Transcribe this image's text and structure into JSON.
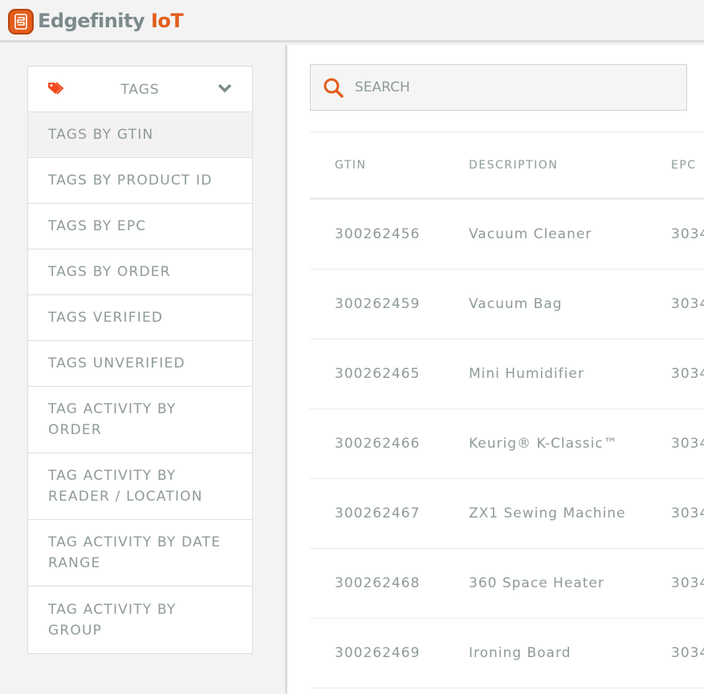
{
  "header": {
    "brand_main": "Edgefinity",
    "brand_accent": "IoT",
    "accent_color": "#e35d1c"
  },
  "sidebar": {
    "menu_title": "TAGS",
    "menu_icon": "tags-icon",
    "items": [
      {
        "label": "TAGS BY GTIN",
        "active": true
      },
      {
        "label": "TAGS BY PRODUCT ID"
      },
      {
        "label": "TAGS BY EPC"
      },
      {
        "label": "TAGS BY ORDER"
      },
      {
        "label": "TAGS VERIFIED"
      },
      {
        "label": "TAGS UNVERIFIED"
      },
      {
        "label": "TAG ACTIVITY BY ORDER"
      },
      {
        "label": "TAG ACTIVITY BY READER / LOCATION"
      },
      {
        "label": "TAG ACTIVITY BY DATE RANGE"
      },
      {
        "label": "TAG ACTIVITY BY GROUP"
      }
    ]
  },
  "search": {
    "placeholder": "SEARCH",
    "value": ""
  },
  "table": {
    "columns": [
      "GTIN",
      "DESCRIPTION",
      "EPC"
    ],
    "rows": [
      {
        "gtin": "300262456",
        "description": "Vacuum Cleaner",
        "epc": "3034"
      },
      {
        "gtin": "300262459",
        "description": "Vacuum Bag",
        "epc": "3034"
      },
      {
        "gtin": "300262465",
        "description": "Mini Humidifier",
        "epc": "3034"
      },
      {
        "gtin": "300262466",
        "description": "Keurig® K-Classic™",
        "epc": "3034"
      },
      {
        "gtin": "300262467",
        "description": "ZX1 Sewing Machine",
        "epc": "3034"
      },
      {
        "gtin": "300262468",
        "description": "360 Space Heater",
        "epc": "3034"
      },
      {
        "gtin": "300262469",
        "description": "Ironing Board",
        "epc": "3034"
      }
    ]
  }
}
